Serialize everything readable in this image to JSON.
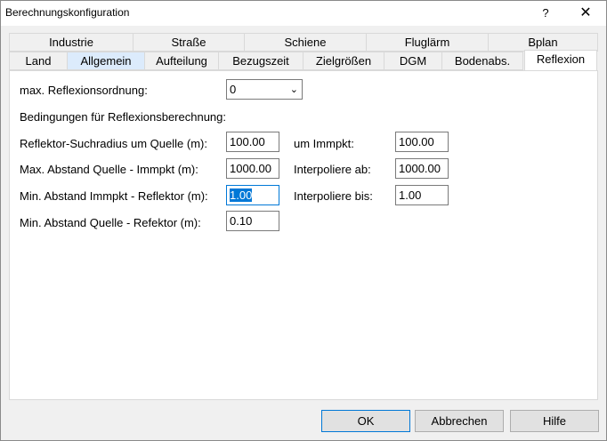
{
  "window": {
    "title": "Berechnungskonfiguration",
    "help_glyph": "?",
    "close_glyph": "✕"
  },
  "tabs_row1": [
    "Industrie",
    "Straße",
    "Schiene",
    "Fluglärm",
    "Bplan"
  ],
  "tabs_row2": [
    "Land",
    "Allgemein",
    "Aufteilung",
    "Bezugszeit",
    "Zielgrößen",
    "DGM",
    "Bodenabs.",
    "Reflexion"
  ],
  "form": {
    "order_label": "max. Reflexionsordnung:",
    "order_value": "0",
    "conditions_label": "Bedingungen für Reflexionsberechnung:",
    "r1_label": "Reflektor-Suchradius um Quelle (m):",
    "r1_value": "100.00",
    "r2_label": "Max. Abstand Quelle - Immpkt (m):",
    "r2_value": "1000.00",
    "r3_label": "Min. Abstand Immpkt - Reflektor (m):",
    "r3_value": "1.00",
    "r4_label": "Min. Abstand Quelle - Refektor (m):",
    "r4_value": "0.10",
    "c1_label": "um Immpkt:",
    "c1_value": "100.00",
    "c2_label": "Interpoliere ab:",
    "c2_value": "1000.00",
    "c3_label": "Interpoliere bis:",
    "c3_value": "1.00"
  },
  "buttons": {
    "ok": "OK",
    "cancel": "Abbrechen",
    "help": "Hilfe"
  }
}
